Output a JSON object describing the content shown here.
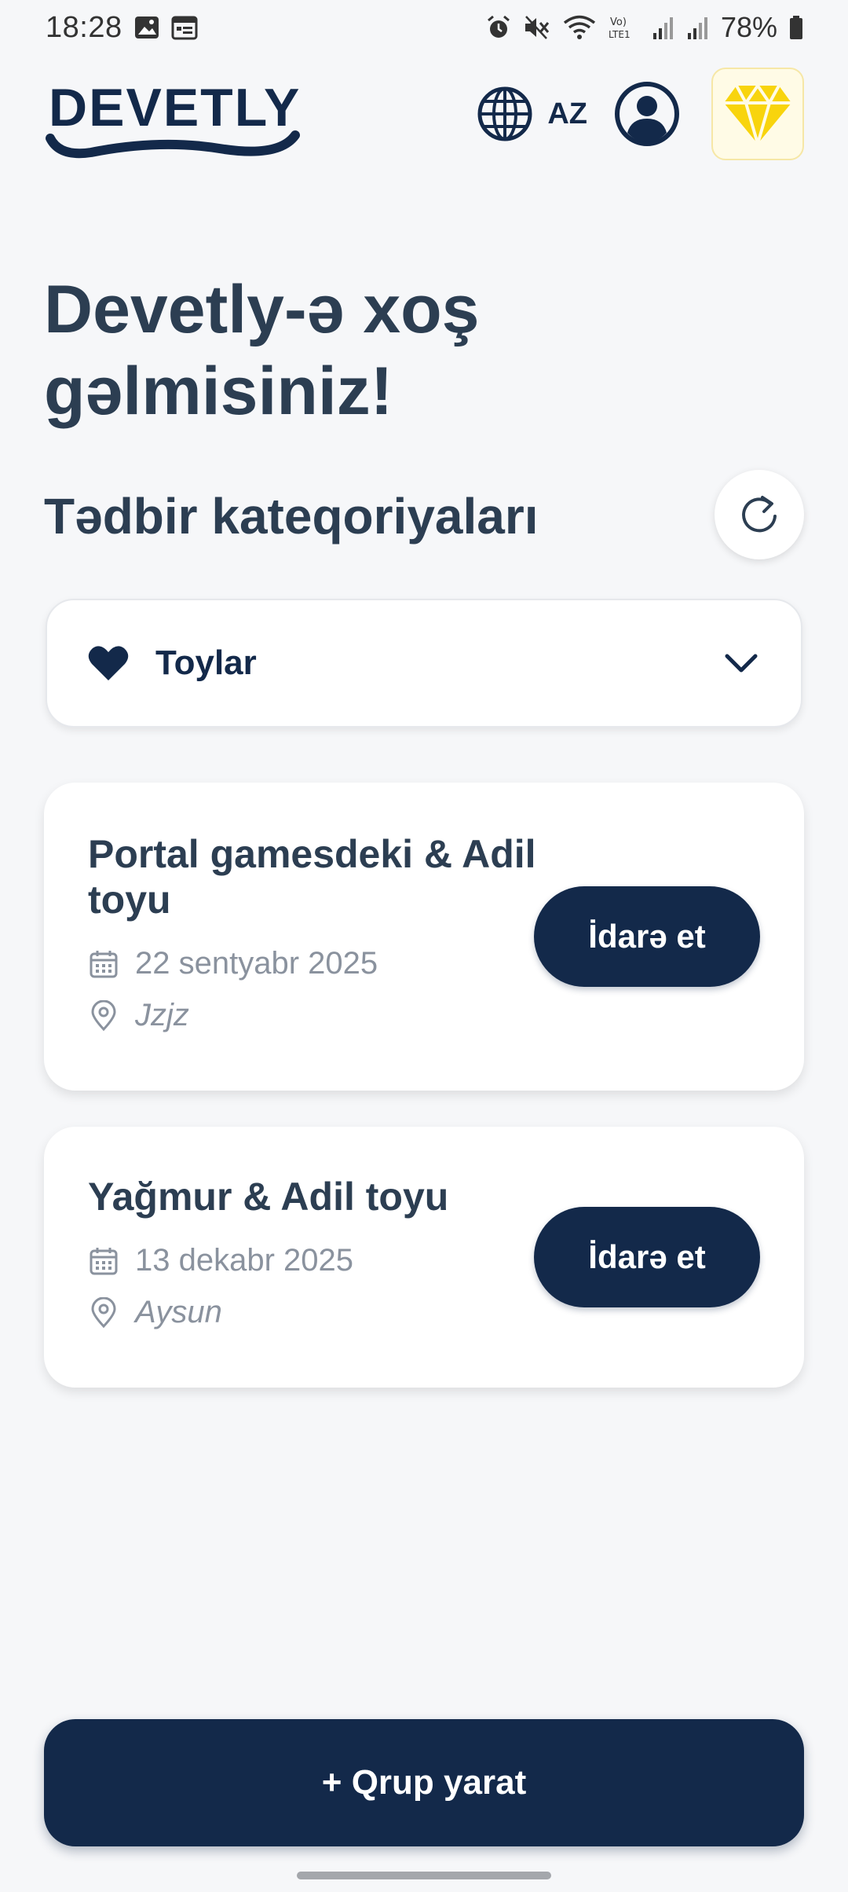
{
  "status_bar": {
    "time": "18:28",
    "battery": "78%",
    "network_label": "Vo) LTE1"
  },
  "header": {
    "logo_text": "DEVETLY",
    "language": "AZ"
  },
  "welcome": {
    "title": "Devetly-ə xoş gəlmisiniz!"
  },
  "categories": {
    "title": "Tədbir kateqoriyaları",
    "selected": "Toylar"
  },
  "events": [
    {
      "title": "Portal gamesdeki  & Adil toyu",
      "date": "22 sentyabr 2025",
      "location": "Jzjz",
      "action": "İdarə et"
    },
    {
      "title": "Yağmur & Adil toyu",
      "date": "13 dekabr 2025",
      "location": "Aysun",
      "action": "İdarə et"
    }
  ],
  "create_group": {
    "label": "+ Qrup yarat"
  },
  "icons": {
    "language": "globe-icon",
    "profile": "user-circle-icon",
    "premium": "diamond-icon",
    "refresh": "refresh-icon",
    "category": "heart-icon",
    "dropdown": "chevron-down-icon",
    "date": "calendar-icon",
    "location": "map-pin-icon"
  },
  "colors": {
    "primary": "#13294A",
    "text": "#2C3E52",
    "muted": "#8A929E",
    "background": "#F6F7F9",
    "premium": "#F8D40D"
  }
}
